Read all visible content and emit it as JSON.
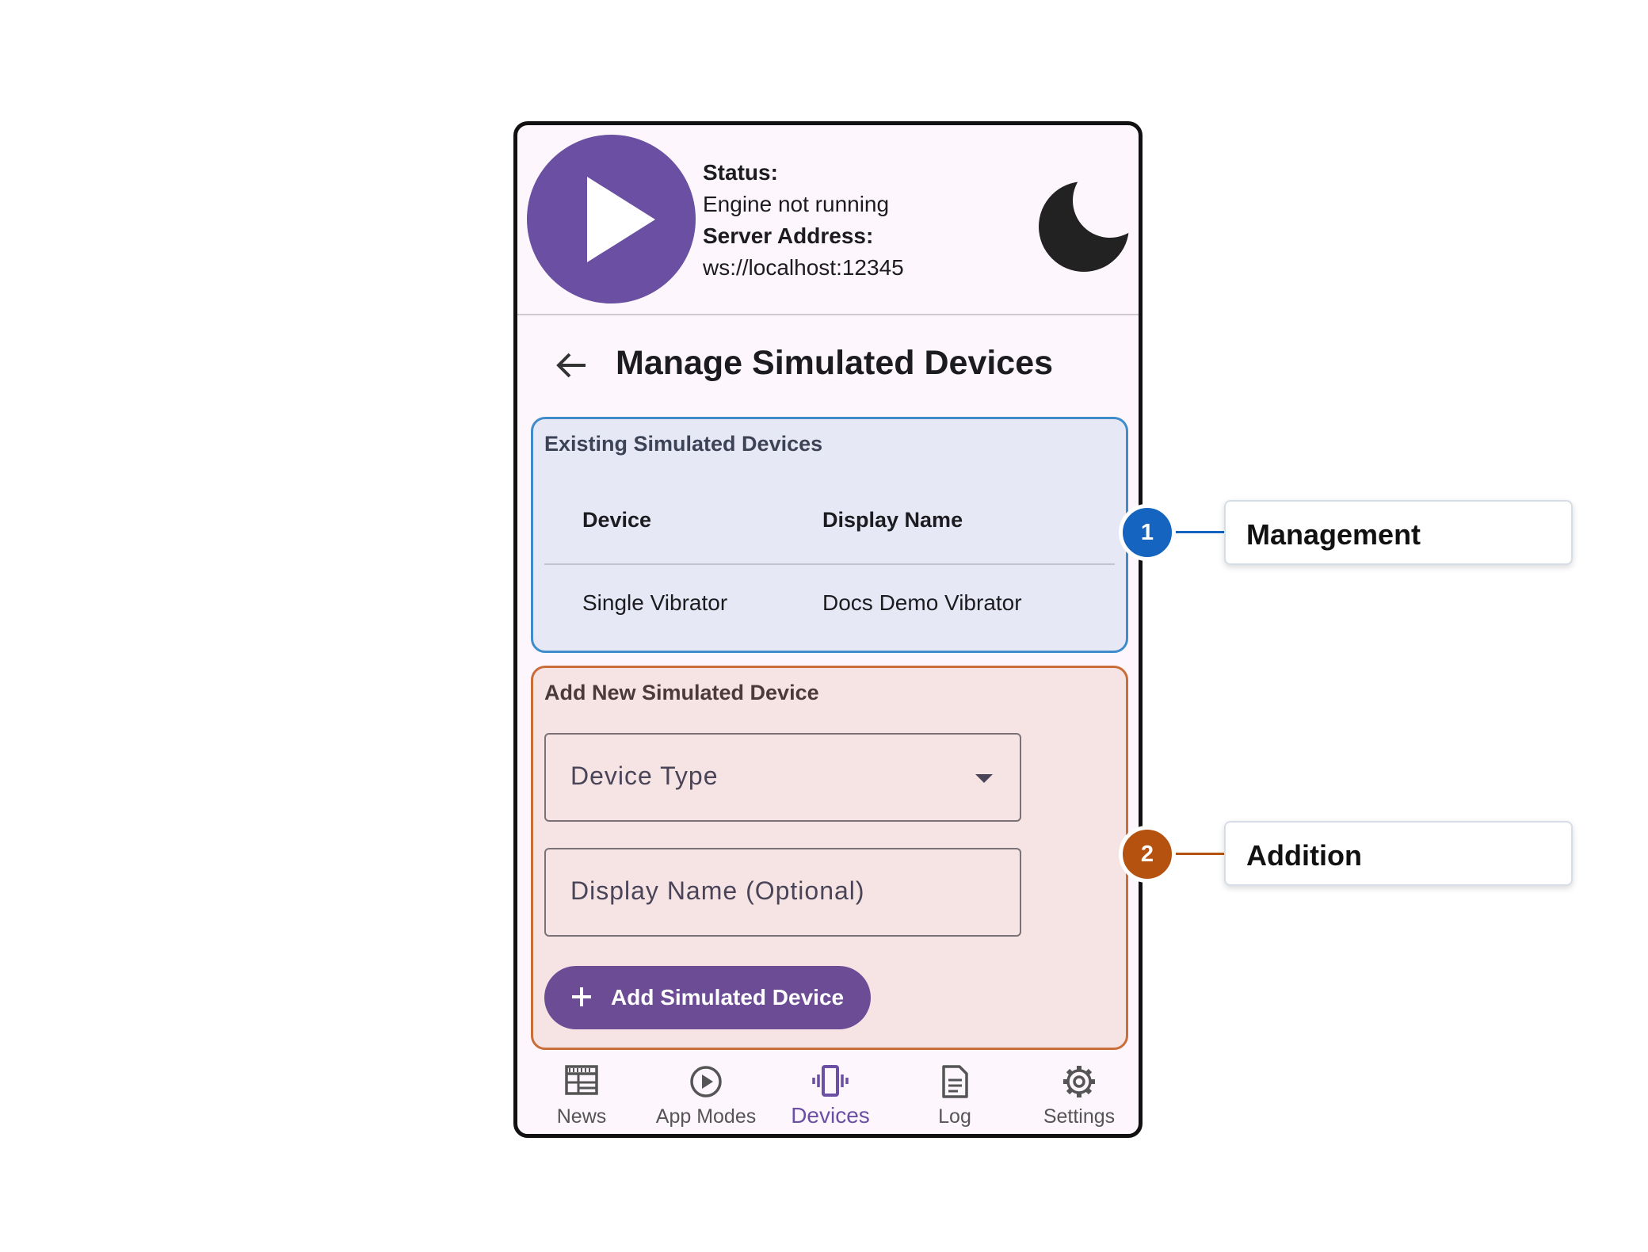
{
  "header": {
    "status_label": "Status:",
    "status_value": "Engine not running",
    "server_label": "Server Address:",
    "server_value": "ws://localhost:12345"
  },
  "page": {
    "title": "Manage Simulated Devices"
  },
  "existing": {
    "title": "Existing Simulated Devices",
    "columns": [
      "Device",
      "Display Name"
    ],
    "rows": [
      [
        "Single Vibrator",
        "Docs Demo Vibrator"
      ]
    ]
  },
  "add_device": {
    "title": "Add New Simulated Device",
    "device_type_label": "Device Type",
    "display_name_label": "Display Name (Optional)",
    "button_label": "Add Simulated Device"
  },
  "nav": {
    "items": [
      {
        "label": "News",
        "icon": "news-icon"
      },
      {
        "label": "App Modes",
        "icon": "play-circle-icon"
      },
      {
        "label": "Devices",
        "icon": "vibration-icon",
        "active": true
      },
      {
        "label": "Log",
        "icon": "log-icon"
      },
      {
        "label": "Settings",
        "icon": "gear-icon"
      }
    ]
  },
  "callouts": [
    {
      "number": "1",
      "label": "Management",
      "color": "#1565c0"
    },
    {
      "number": "2",
      "label": "Addition",
      "color": "#b5520f"
    }
  ],
  "colors": {
    "accent": "#6a4fa3",
    "management_border": "#3f8ccb",
    "addition_border": "#c96d3a"
  }
}
